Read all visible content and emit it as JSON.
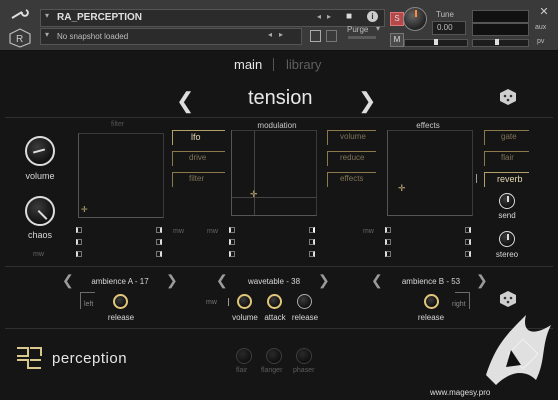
{
  "header": {
    "instrument_name": "RA_PERCEPTION",
    "snapshot_text": "No snapshot loaded",
    "purge_label": "Purge",
    "tune_label": "Tune",
    "tune_value": "0.00",
    "solo_label": "S",
    "mute_label": "M",
    "aux_label": "aux",
    "pv_label": "pv"
  },
  "nav": {
    "tab_main": "main",
    "tab_library": "library",
    "preset_name": "tension"
  },
  "sections": {
    "filter": "filter",
    "modulation": "modulation",
    "effects": "effects"
  },
  "left": {
    "volume_label": "volume",
    "chaos_label": "chaos",
    "mw_label": "mw"
  },
  "filter_buttons": [
    "lfo",
    "drive",
    "filter"
  ],
  "modulation_buttons": [
    "volume",
    "reduce",
    "effects"
  ],
  "effects_buttons": [
    "gate",
    "flair",
    "reverb"
  ],
  "mw_mid_left": "mw",
  "mw_mid_right": "mw",
  "mw_effects": "mw",
  "right_knobs": {
    "send": "send",
    "stereo": "stereo"
  },
  "engines": {
    "a": {
      "name": "ambience A - 17",
      "knob": "release",
      "side": "left"
    },
    "wt": {
      "name": "wavetable - 38",
      "mw": "mw",
      "knobs": [
        "volume",
        "attack",
        "release"
      ]
    },
    "b": {
      "name": "ambience B - 53",
      "knob": "release",
      "side": "right"
    }
  },
  "footer": {
    "logo_text": "perception",
    "fx_knobs": [
      "flair",
      "flanger",
      "phaser"
    ],
    "watermark": "www.magesy.pro"
  },
  "colors": {
    "accent_gold": "#b4a069",
    "background": "#151515",
    "header": "#3a3a3a"
  }
}
